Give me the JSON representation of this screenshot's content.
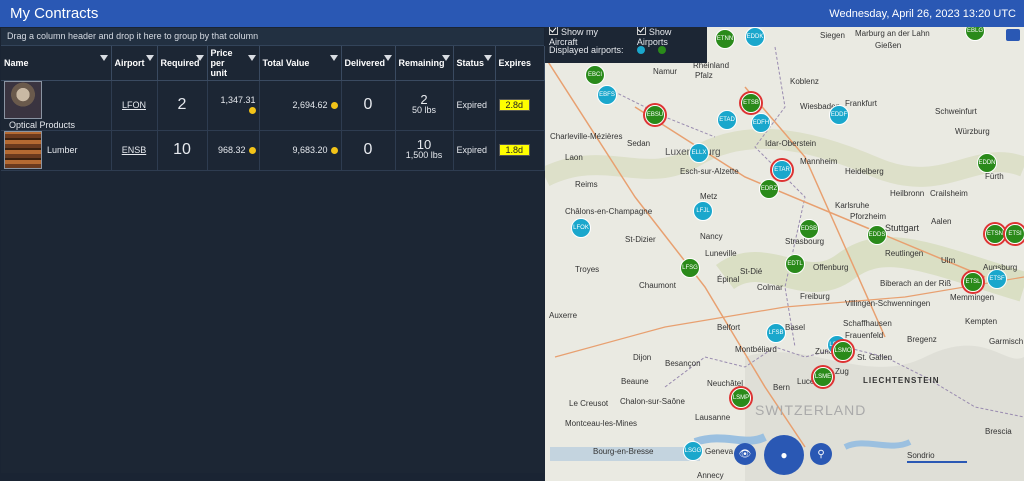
{
  "window": {
    "title": "My Contracts",
    "datetime": "Wednesday, April 26, 2023 13:20 UTC"
  },
  "grid": {
    "group_hint": "Drag a column header and drop it here to group by that column",
    "columns": [
      "Name",
      "Airport",
      "Required",
      "Price per unit",
      "Total Value",
      "Delivered",
      "Remaining",
      "Status",
      "Expires"
    ],
    "rows": [
      {
        "name": "Optical Products",
        "airport": "LFON",
        "required": "2",
        "price": "1,347.31",
        "total": "2,694.62",
        "delivered": "0",
        "remaining": "2",
        "remaining_weight": "50 lbs",
        "status": "Expired",
        "expires": "2.8d"
      },
      {
        "name": "Lumber",
        "airport": "ENSB",
        "required": "10",
        "price": "968.32",
        "total": "9,683.20",
        "delivered": "0",
        "remaining": "10",
        "remaining_weight": "1,500 lbs",
        "status": "Expired",
        "expires": "1.8d"
      }
    ]
  },
  "map": {
    "show_aircraft": "Show my Aircraft",
    "show_airports": "Show Airports",
    "displayed_airports": "Displayed airports:",
    "colors": {
      "airport_blue": "#1aa7cc",
      "airport_green": "#2a8a1a",
      "ring_red": "#dd3333"
    },
    "places": [
      "Siegen",
      "Marburg an der Lahn",
      "Gießen",
      "Koblenz",
      "Frankfurt",
      "Wiesbaden",
      "Schweinfurt",
      "Namur",
      "Würzburg",
      "Idar-Oberstein",
      "Luxembourg",
      "Mannheim",
      "Heidelberg",
      "Esch-sur-Alzette",
      "Charleville-Mézières",
      "Sedan",
      "Reims",
      "Metz",
      "Heilbronn",
      "Karlsruhe",
      "Crailsheim",
      "Fürth",
      "Pforzheim",
      "Stuttgart",
      "Aalen",
      "Châlons-en-Champagne",
      "St-Dizier",
      "Nancy",
      "Strasbourg",
      "Reutlingen",
      "Troyes",
      "Luneville",
      "Chaumont",
      "Épinal",
      "St-Dié",
      "Offenburg",
      "Ulm",
      "Augsburg",
      "Colmar",
      "Freiburg",
      "Biberach an der Riß",
      "Memmingen",
      "Kempten",
      "Villingen-Schwenningen",
      "Auxerre",
      "Belfort",
      "Basel",
      "Schaffhausen",
      "Dijon",
      "Montbéliard",
      "Frauenfeld",
      "St. Gallen",
      "Zurich",
      "Bregenz",
      "Besançon",
      "Beaune",
      "Neuchâtel",
      "Lucerne",
      "Zug",
      "LIECHTENSTEIN",
      "Chalon-sur-Saône",
      "Bern",
      "Le Creusot",
      "Lausanne",
      "Montceau-les-Mines",
      "Geneva",
      "Sondrio",
      "Annecy",
      "Bourg-en-Bresse",
      "Rheinland",
      "Pfalz",
      "Garmisch",
      "Laon",
      "Brescia"
    ],
    "airports": [
      {
        "code": "ETNN",
        "type": "g"
      },
      {
        "code": "EDDK",
        "type": "a"
      },
      {
        "code": "EBCI",
        "type": "g"
      },
      {
        "code": "EBFS",
        "type": "a"
      },
      {
        "code": "EBSU",
        "type": "g",
        "ring": true
      },
      {
        "code": "ETSB",
        "type": "g",
        "ring": true
      },
      {
        "code": "ETAD",
        "type": "a"
      },
      {
        "code": "EDFH",
        "type": "a"
      },
      {
        "code": "EDDF",
        "type": "a"
      },
      {
        "code": "ELLX",
        "type": "a"
      },
      {
        "code": "ETAR",
        "type": "a",
        "ring": true
      },
      {
        "code": "EDRZ",
        "type": "g"
      },
      {
        "code": "EDDN",
        "type": "g"
      },
      {
        "code": "LFJL",
        "type": "a"
      },
      {
        "code": "EDSB",
        "type": "g"
      },
      {
        "code": "EDDS",
        "type": "g"
      },
      {
        "code": "LFOK",
        "type": "a"
      },
      {
        "code": "LFSG",
        "type": "g"
      },
      {
        "code": "EDTL",
        "type": "g"
      },
      {
        "code": "ETSN",
        "type": "g",
        "ring": true
      },
      {
        "code": "ETSI",
        "type": "g",
        "ring": true
      },
      {
        "code": "ETSL",
        "type": "g",
        "ring": true
      },
      {
        "code": "ETSF",
        "type": "a"
      },
      {
        "code": "LFSB",
        "type": "a"
      },
      {
        "code": "LSZH",
        "type": "a"
      },
      {
        "code": "LSMO",
        "type": "g",
        "ring": true
      },
      {
        "code": "LSME",
        "type": "g",
        "ring": true
      },
      {
        "code": "LSMP",
        "type": "g",
        "ring": true
      },
      {
        "code": "LSGG",
        "type": "a"
      },
      {
        "code": "EBLG",
        "type": "g"
      }
    ],
    "country_label": "SWITZERLAND"
  }
}
